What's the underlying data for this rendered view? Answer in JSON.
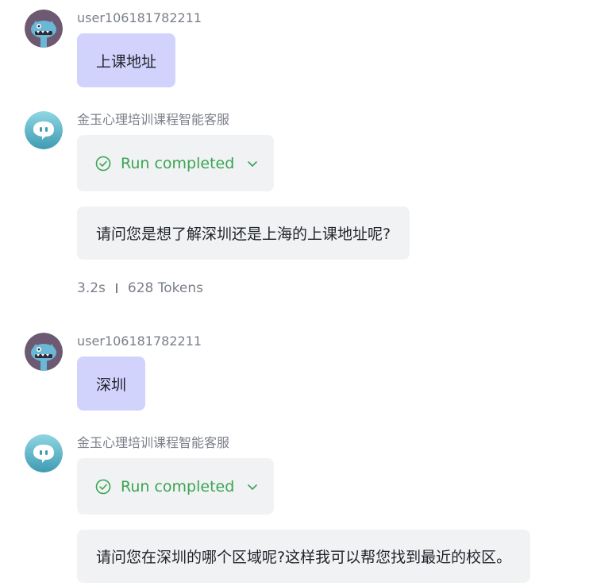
{
  "messages": [
    {
      "role": "user",
      "sender": "user106181782211",
      "text": "上课地址"
    },
    {
      "role": "bot",
      "sender": "金玉心理培训课程智能客服",
      "run_status": "Run completed",
      "text": "请问您是想了解深圳还是上海的上课地址呢?",
      "time": "3.2s",
      "tokens": "628 Tokens"
    },
    {
      "role": "user",
      "sender": "user106181782211",
      "text": "深圳"
    },
    {
      "role": "bot",
      "sender": "金玉心理培训课程智能客服",
      "run_status": "Run completed",
      "text": "请问您在深圳的哪个区域呢?这样我可以帮您找到最近的校区。"
    }
  ],
  "colors": {
    "user_bubble": "#d1d3fc",
    "bot_bubble": "#f1f2f4",
    "success_green": "#3aa552",
    "muted_text": "#7a7f89"
  },
  "icons": {
    "user_avatar": "monster-avatar-icon",
    "bot_avatar": "chat-bot-avatar-icon",
    "status": "check-circle-icon",
    "expand": "chevron-down-icon"
  }
}
